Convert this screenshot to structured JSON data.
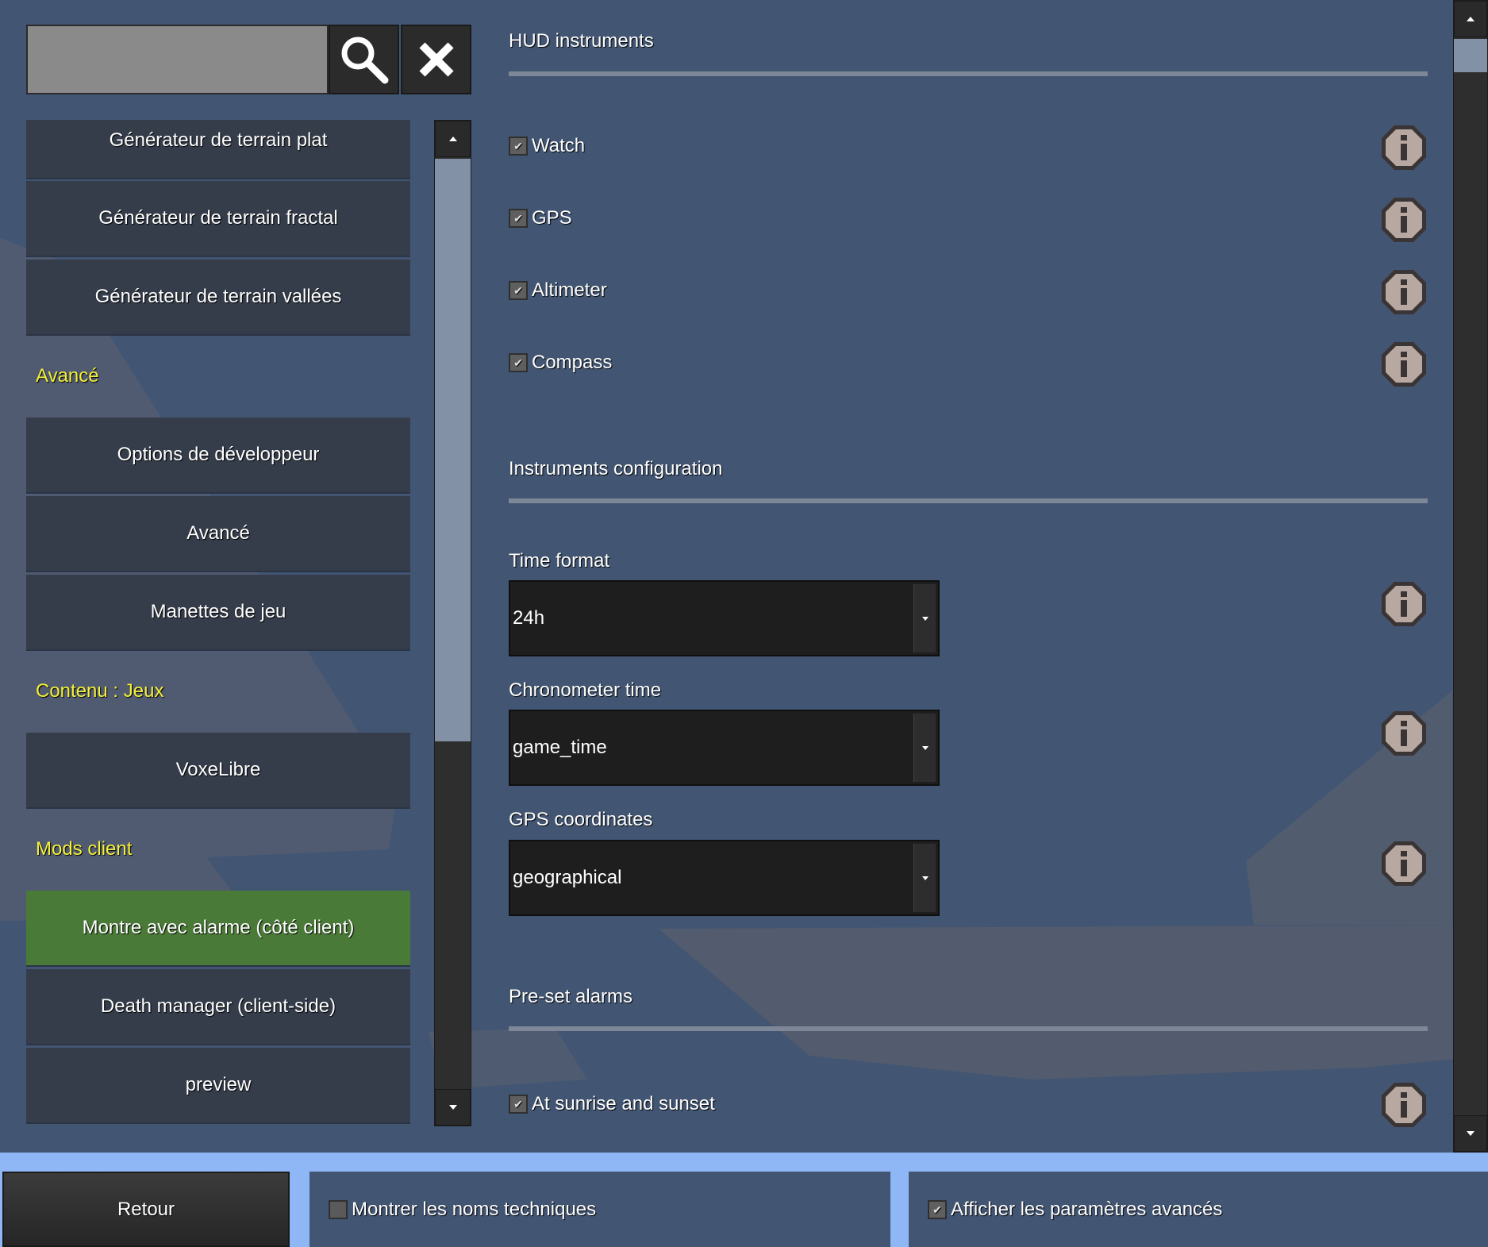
{
  "search": {
    "placeholder": "",
    "value": ""
  },
  "toolbar": {
    "search_icon": "magnifier-icon",
    "clear_icon": "close-icon"
  },
  "sidebar": {
    "items": [
      {
        "type": "button",
        "label": "Générateur de terrain plat"
      },
      {
        "type": "button",
        "label": "Générateur de terrain fractal"
      },
      {
        "type": "button",
        "label": "Générateur de terrain vallées"
      },
      {
        "type": "section",
        "label": "Avancé"
      },
      {
        "type": "button",
        "label": "Options de développeur"
      },
      {
        "type": "button",
        "label": "Avancé"
      },
      {
        "type": "button",
        "label": "Manettes de jeu"
      },
      {
        "type": "section",
        "label": "Contenu : Jeux"
      },
      {
        "type": "button",
        "label": "VoxeLibre"
      },
      {
        "type": "section",
        "label": "Mods client"
      },
      {
        "type": "button",
        "label": "Montre avec alarme (côté client)",
        "selected": true
      },
      {
        "type": "button",
        "label": "Death manager (client-side)"
      },
      {
        "type": "button",
        "label": "preview"
      }
    ]
  },
  "settings": {
    "hud_heading": "HUD instruments",
    "hud_items": [
      {
        "label": "Watch",
        "checked": true
      },
      {
        "label": "GPS",
        "checked": true
      },
      {
        "label": "Altimeter",
        "checked": true
      },
      {
        "label": "Compass",
        "checked": true
      }
    ],
    "config_heading": "Instruments configuration",
    "time_format": {
      "label": "Time format",
      "value": "24h"
    },
    "chrono_time": {
      "label": "Chronometer time",
      "value": "game_time"
    },
    "gps_coords": {
      "label": "GPS coordinates",
      "value": "geographical"
    },
    "alarms_heading": "Pre-set alarms",
    "alarm_items": [
      {
        "label": "At sunrise and sunset",
        "checked": true
      }
    ]
  },
  "footer": {
    "back_label": "Retour",
    "technical_names": {
      "label": "Montrer les noms techniques",
      "checked": false
    },
    "advanced_settings": {
      "label": "Afficher les paramètres avancés",
      "checked": true
    }
  },
  "colors": {
    "panel_bg": "#425673",
    "selected_item": "#4a7a37",
    "section_heading": "#f4f03a",
    "footer_bg": "#8fb7f5"
  }
}
